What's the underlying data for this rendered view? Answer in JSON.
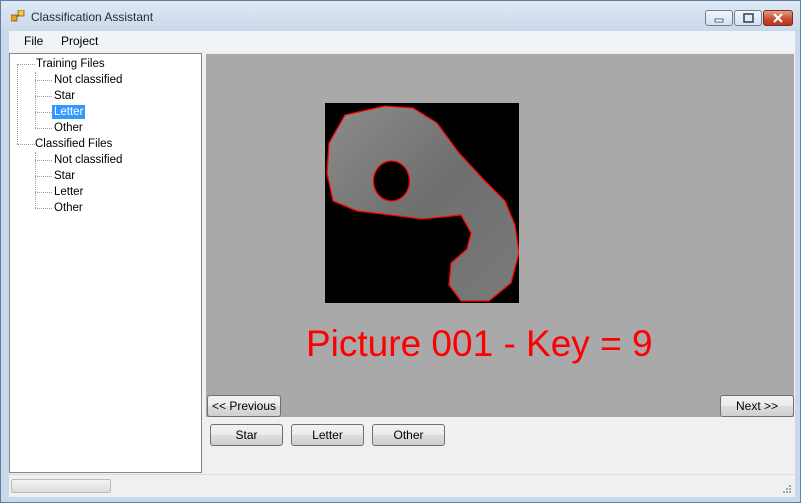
{
  "window": {
    "title": "Classification Assistant",
    "icon": "app-icon"
  },
  "menu": {
    "file": "File",
    "project": "Project"
  },
  "tree": {
    "training": {
      "label": "Training Files",
      "children": [
        "Not classified",
        "Star",
        "Letter",
        "Other"
      ]
    },
    "classified": {
      "label": "Classified Files",
      "children": [
        "Not classified",
        "Star",
        "Letter",
        "Other"
      ]
    },
    "selected": "Training Files / Letter"
  },
  "viewer": {
    "caption": "Picture 001 - Key = 9",
    "caption_color": "#ff0000",
    "contour_color": "#ff0000"
  },
  "nav": {
    "previous": "<< Previous",
    "next": "Next >>"
  },
  "classify_buttons": [
    "Star",
    "Letter",
    "Other"
  ]
}
